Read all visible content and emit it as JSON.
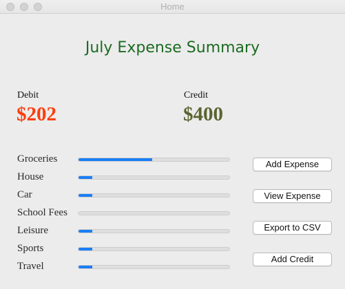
{
  "window": {
    "title": "Home"
  },
  "page": {
    "title": "July Expense Summary"
  },
  "summary": {
    "debit_label": "Debit",
    "debit_value": "$202",
    "credit_label": "Credit",
    "credit_value": "$400"
  },
  "colors": {
    "title": "#1c6b22",
    "debit": "#fc3d0c",
    "credit": "#5b6431",
    "progress_fill": "#1b7ef6"
  },
  "categories": [
    {
      "label": "Groceries",
      "fraction": 0.49
    },
    {
      "label": "House",
      "fraction": 0.09
    },
    {
      "label": "Car",
      "fraction": 0.09
    },
    {
      "label": "School Fees",
      "fraction": 0.0
    },
    {
      "label": "Leisure",
      "fraction": 0.09
    },
    {
      "label": "Sports",
      "fraction": 0.09
    },
    {
      "label": "Travel",
      "fraction": 0.09
    }
  ],
  "buttons": {
    "add_expense": "Add Expense",
    "view_expense": "View Expense",
    "export_csv": "Export to CSV",
    "add_credit": "Add Credit"
  }
}
